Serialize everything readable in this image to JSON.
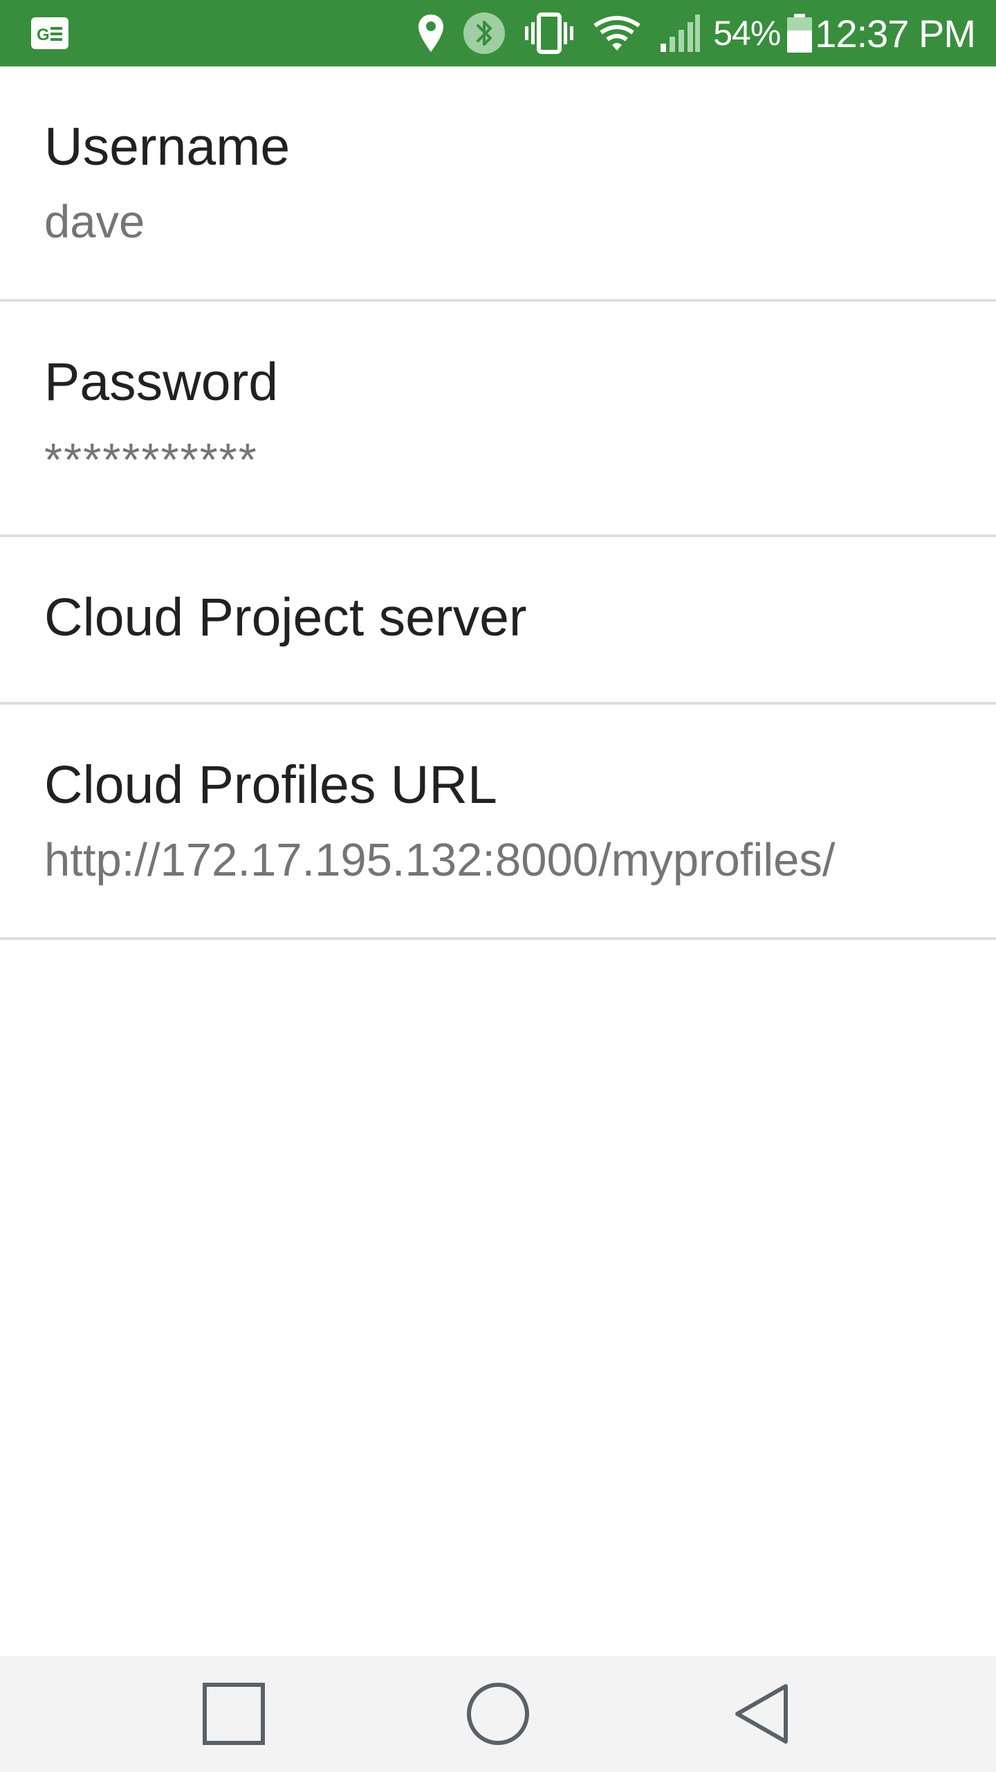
{
  "status_bar": {
    "notification_icon": "ge-notification-icon",
    "icons": [
      "location-icon",
      "bluetooth-icon",
      "vibrate-icon",
      "wifi-icon",
      "cell-signal-icon"
    ],
    "battery_percent": "54%",
    "time": "12:37 PM",
    "background_color": "#388e3c"
  },
  "preferences": [
    {
      "title": "Username",
      "summary": "dave"
    },
    {
      "title": "Password",
      "summary": "***********"
    },
    {
      "title": "Cloud Project server",
      "summary": ""
    },
    {
      "title": "Cloud Profiles URL",
      "summary": "http://172.17.195.132:8000/myprofiles/"
    }
  ],
  "nav_bar": {
    "buttons": [
      "recents-icon",
      "home-icon",
      "back-icon"
    ]
  }
}
